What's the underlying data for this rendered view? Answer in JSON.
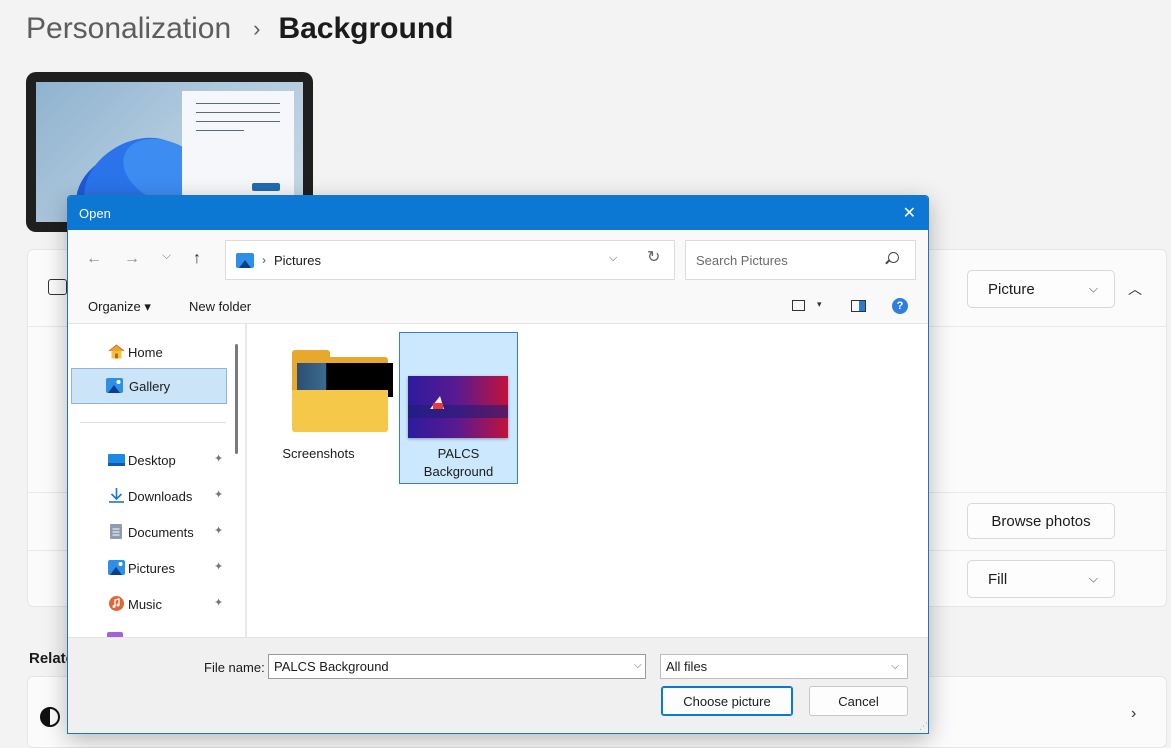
{
  "settings": {
    "breadcrumb_parent": "Personalization",
    "breadcrumb_separator": "›",
    "breadcrumb_current": "Background",
    "background_type_value": "Picture",
    "browse_photos_label": "Browse photos",
    "fit_value": "Fill",
    "related_label": "Relate"
  },
  "dialog": {
    "title": "Open",
    "close_glyph": "✕",
    "nav": {
      "back": "←",
      "forward": "→",
      "recent": "⌵",
      "up": "↑"
    },
    "address": {
      "separator": "›",
      "location": "Pictures",
      "dropdown": "⌵",
      "refresh": "↻"
    },
    "search_placeholder": "Search Pictures",
    "toolbar": {
      "organize": "Organize ▾",
      "new_folder": "New folder",
      "view_dropdown": "▾",
      "help": "?"
    },
    "sidebar": [
      {
        "label": "Home",
        "icon": "home-icon",
        "pinned": false
      },
      {
        "label": "Gallery",
        "icon": "gallery-icon",
        "pinned": false,
        "selected": true
      },
      {
        "label": "Desktop",
        "icon": "desktop-icon",
        "pinned": true
      },
      {
        "label": "Downloads",
        "icon": "downloads-icon",
        "pinned": true
      },
      {
        "label": "Documents",
        "icon": "documents-icon",
        "pinned": true
      },
      {
        "label": "Pictures",
        "icon": "pictures-icon",
        "pinned": true
      },
      {
        "label": "Music",
        "icon": "music-icon",
        "pinned": true
      }
    ],
    "pin_glyph": "📌",
    "files": [
      {
        "name": "Screenshots",
        "type": "folder"
      },
      {
        "name_line1": "PALCS",
        "name_line2": "Background",
        "type": "image",
        "selected": true
      }
    ],
    "footer": {
      "file_name_label": "File name:",
      "file_name_value": "PALCS Background",
      "file_type_value": "All files",
      "dropdown": "⌵",
      "choose_label": "Choose picture",
      "cancel_label": "Cancel"
    }
  },
  "colors": {
    "accent": "#0c78d4",
    "selection": "#cce8ff",
    "folder": "#f5c84a"
  }
}
